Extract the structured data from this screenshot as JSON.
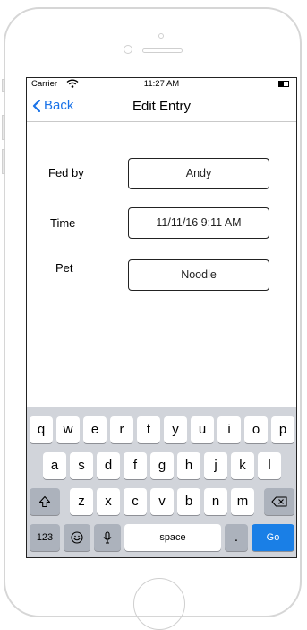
{
  "status_bar": {
    "carrier": "Carrier",
    "time": "11:27 AM"
  },
  "nav": {
    "back_label": "Back",
    "title": "Edit Entry"
  },
  "form": {
    "fed_by": {
      "label": "Fed by",
      "value": "Andy"
    },
    "time": {
      "label": "Time",
      "value": "11/11/16 9:11 AM"
    },
    "pet": {
      "label": "Pet",
      "value": "Noodle"
    }
  },
  "keyboard": {
    "row1": [
      "q",
      "w",
      "e",
      "r",
      "t",
      "y",
      "u",
      "i",
      "o",
      "p"
    ],
    "row2": [
      "a",
      "s",
      "d",
      "f",
      "g",
      "h",
      "j",
      "k",
      "l"
    ],
    "row3": [
      "z",
      "x",
      "c",
      "v",
      "b",
      "n",
      "m"
    ],
    "numbers_key": "123",
    "space_key": "space",
    "period_key": ".",
    "go_key": "Go"
  },
  "colors": {
    "accent": "#1a73e8",
    "go_key": "#1a7fe6",
    "keyboard_bg": "#d1d4da"
  }
}
